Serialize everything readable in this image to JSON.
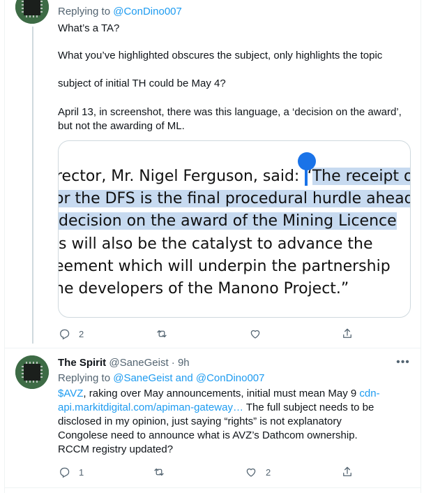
{
  "tweet1": {
    "replying_prefix": "Replying to",
    "replying_handle": "@ConDino007",
    "paragraphs": [
      "What’s a TA?",
      "What you’ve highlighted obscures the subject, only highlights the topic",
      "subject of initial TH could be May 4?",
      "April 13, in screenshot, there was this language, a ‘decision on the award’, but not the awarding of ML."
    ],
    "media": {
      "lines": [
        {
          "before": "rector, Mr. Nigel Ferguson, said: “",
          "hl": "The receipt of"
        },
        {
          "before": "",
          "hl": "or the DFS is the final procedural hurdle ahead"
        },
        {
          "before": "",
          "hl": "decision on the award of the Mining Licence"
        },
        {
          "before": "s will also be the catalyst to advance the",
          "hl": ""
        },
        {
          "before": "eement which will underpin the partnership",
          "hl": ""
        },
        {
          "before": "ne developers of the Manono Project.”",
          "hl": ""
        }
      ]
    },
    "actions": {
      "reply_count": "2",
      "retweet_count": "",
      "like_count": "",
      "share_count": ""
    }
  },
  "tweet2": {
    "name": "The Spirit",
    "handle": "@SaneGeist",
    "dot": "·",
    "time": "9h",
    "more_icon": "more-icon",
    "replying_prefix": "Replying to",
    "replying_handle_1": "@SaneGeist",
    "replying_and": "and",
    "replying_handle_2": "@ConDino007",
    "body_link_1": "$AVZ",
    "body_text_1": ", raking over May announcements, initial must mean May 9 ",
    "body_link_2": "cdn-api.markitdigital.com/apiman-gateway…",
    "body_text_2": "  The full subject needs to be disclosed in my opinion, just saying “rights” is not explanatory Congolese need to announce what is AVZ’s Dathcom ownership. RCCM registry updated?",
    "actions": {
      "reply_count": "1",
      "retweet_count": "",
      "like_count": "2",
      "share_count": ""
    }
  },
  "colors": {
    "accent": "#1d9bf0",
    "muted": "#536471",
    "highlight": "#c7daf0"
  }
}
